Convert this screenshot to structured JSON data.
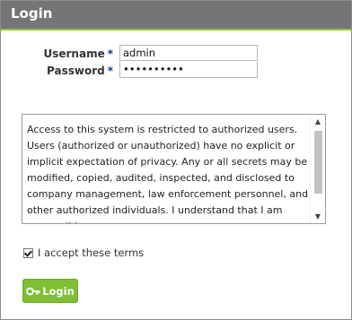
{
  "window": {
    "title": "Login"
  },
  "form": {
    "username_label": "Username",
    "password_label": "Password",
    "required_marker": "*",
    "username_value": "admin",
    "password_value": "••••••••••"
  },
  "terms": {
    "text": "Access to this system is restricted to authorized users. Users (authorized or unauthorized) have no explicit or implicit expectation of privacy. Any or all secrets may be modified, copied, audited, inspected, and disclosed to company management, law enforcement personnel, and other authorized individuals. I understand that I am responsible",
    "accept_label": "I accept these terms",
    "accepted": true
  },
  "buttons": {
    "login_label": "Login"
  },
  "colors": {
    "titlebar": "#757575",
    "accent": "#8cc43c",
    "button": "#7fbf33"
  },
  "icons": {
    "login_button": "key-icon",
    "scroll_up": "up-arrow-icon",
    "scroll_down": "down-arrow-icon"
  }
}
